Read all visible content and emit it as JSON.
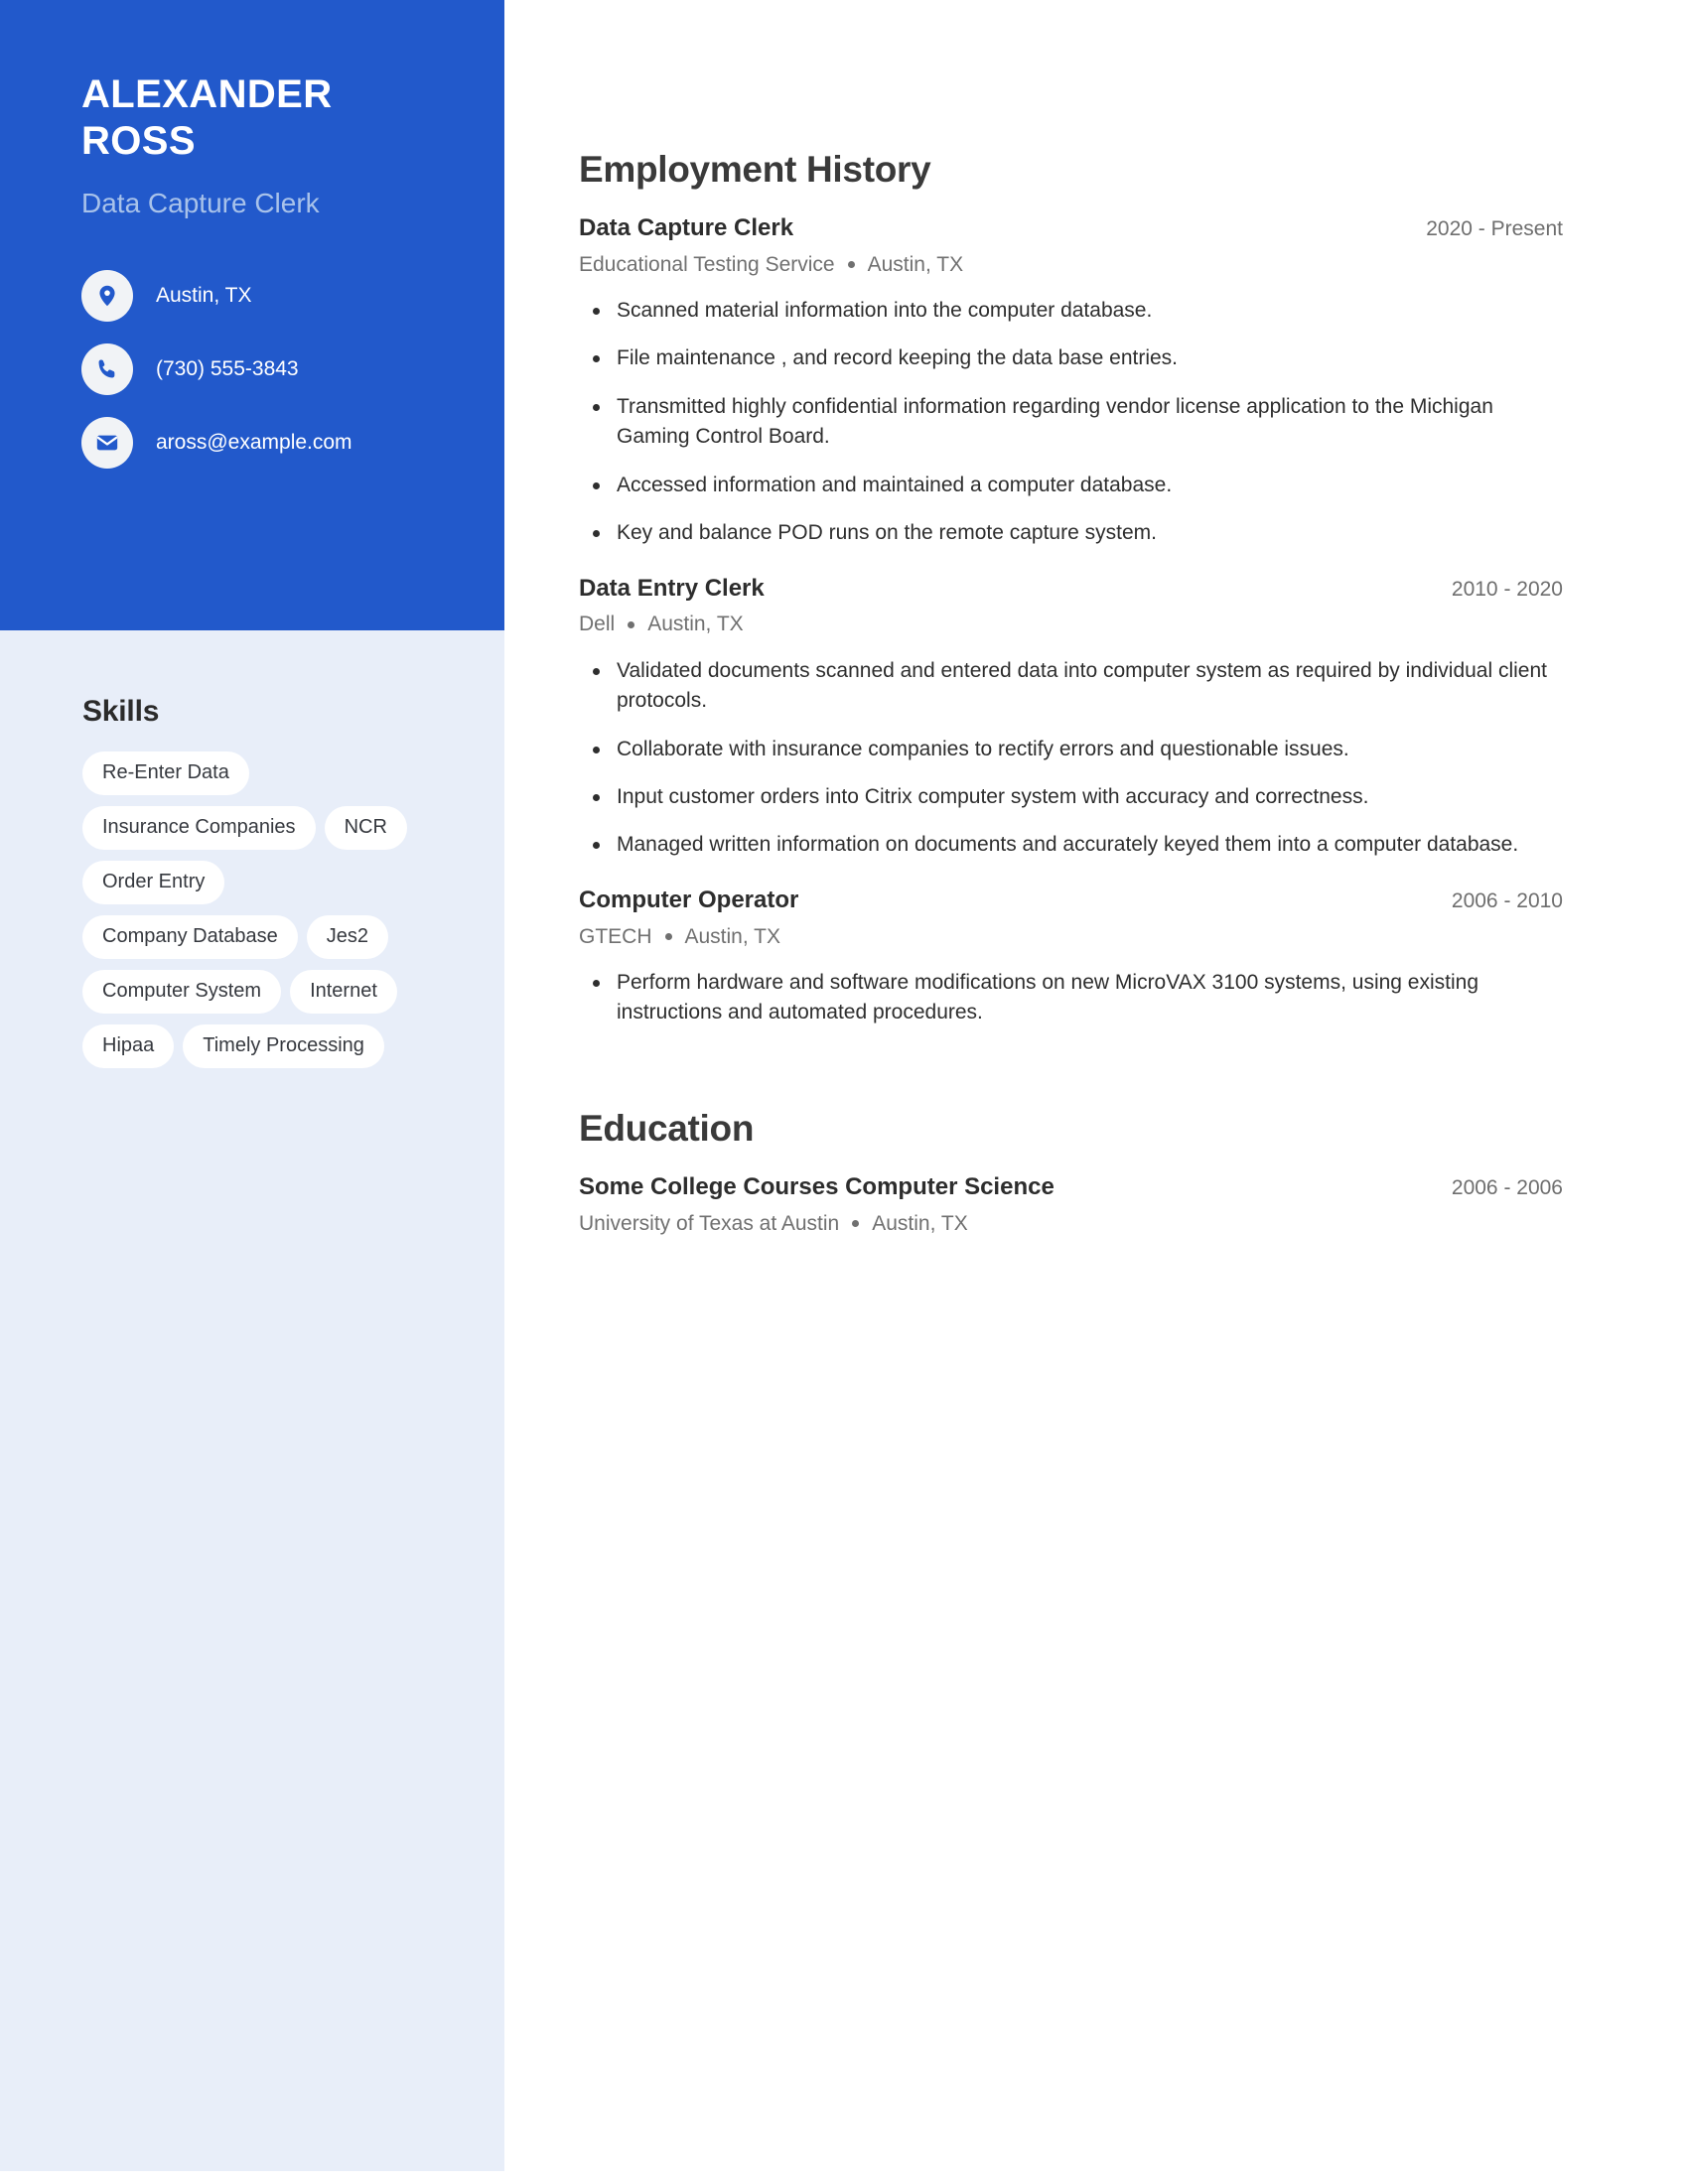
{
  "colors": {
    "accent_blue": "#2259cb",
    "sidebar_bg": "#e8eef9",
    "subtitle_blue": "#a8c2ea",
    "body_text": "#2e2e2e",
    "muted_text": "#707070"
  },
  "sidebar": {
    "full_name": "ALEXANDER ROSS",
    "job_title": "Data Capture Clerk",
    "contacts": [
      {
        "icon": "location-pin-icon",
        "text": "Austin, TX"
      },
      {
        "icon": "phone-icon",
        "text": "(730) 555-3843"
      },
      {
        "icon": "envelope-icon",
        "text": "aross@example.com"
      }
    ],
    "skills": {
      "heading": "Skills",
      "items": [
        "Re-Enter Data",
        "Insurance Companies",
        "NCR",
        "Order Entry",
        "Company Database",
        "Jes2",
        "Computer System",
        "Internet",
        "Hipaa",
        "Timely Processing"
      ]
    }
  },
  "main": {
    "employment": {
      "heading": "Employment History",
      "entries": [
        {
          "title": "Data Capture Clerk",
          "dates": "2020 - Present",
          "company": "Educational Testing Service",
          "location": "Austin, TX",
          "bullets": [
            "Scanned material information into the computer database.",
            "File maintenance , and record keeping the data base entries.",
            "Transmitted highly confidential information regarding vendor license application to the Michigan Gaming Control Board.",
            "Accessed information and maintained a computer database.",
            "Key and balance POD runs on the remote capture system."
          ]
        },
        {
          "title": "Data Entry Clerk",
          "dates": "2010 - 2020",
          "company": "Dell",
          "location": "Austin, TX",
          "bullets": [
            "Validated documents scanned and entered data into computer system as required by individual client protocols.",
            "Collaborate with insurance companies to rectify errors and questionable issues.",
            "Input customer orders into Citrix computer system with accuracy and correctness.",
            "Managed written information on documents and accurately keyed them into a computer database."
          ]
        },
        {
          "title": "Computer Operator",
          "dates": "2006 - 2010",
          "company": "GTECH",
          "location": "Austin, TX",
          "bullets": [
            "Perform hardware and software modifications on new MicroVAX 3100 systems, using existing instructions and automated procedures."
          ]
        }
      ]
    },
    "education": {
      "heading": "Education",
      "entries": [
        {
          "title": "Some College Courses Computer Science",
          "dates": "2006 - 2006",
          "school": "University of Texas at Austin",
          "location": "Austin, TX"
        }
      ]
    }
  }
}
